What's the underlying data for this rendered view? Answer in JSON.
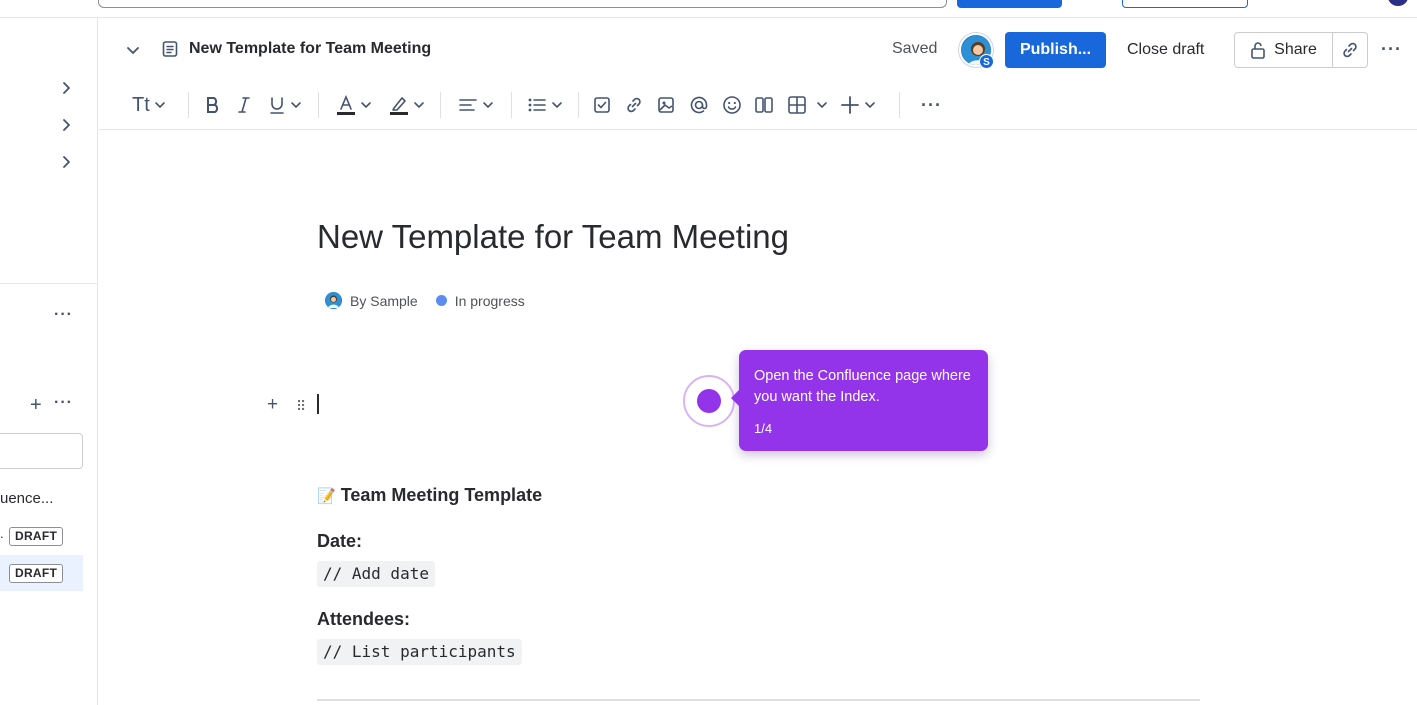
{
  "topbar": {},
  "sidebar": {
    "truncated_item": "uence...",
    "draft_rows": [
      {
        "prefix": ".",
        "badge": "DRAFT"
      },
      {
        "prefix": "",
        "badge": "DRAFT"
      }
    ],
    "more_label": "···",
    "plus_label": "+"
  },
  "header": {
    "page_title": "New Template for Team Meeting",
    "save_status": "Saved",
    "avatar_badge": "S",
    "publish_label": "Publish...",
    "close_draft_label": "Close draft",
    "share_label": "Share",
    "more_label": "···"
  },
  "toolbar": {
    "text_style_label": "Tt",
    "more_label": "···"
  },
  "document": {
    "title": "New Template for Team Meeting",
    "author": "By Sample",
    "status": "In progress",
    "status_color": "#5b8def",
    "heading_emoji": "📝",
    "heading": "Team Meeting Template",
    "date_label": "Date:",
    "date_placeholder": "// Add date",
    "attendees_label": "Attendees:",
    "attendees_placeholder": "// List participants"
  },
  "walkthrough": {
    "text": "Open the Confluence page where you want the Index.",
    "step": "1/4",
    "accent": "#9333ea"
  },
  "colors": {
    "primary": "#1868db"
  }
}
